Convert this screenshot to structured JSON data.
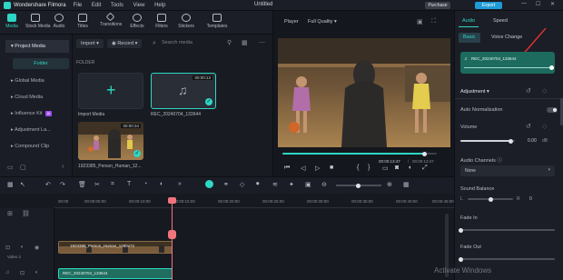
{
  "titlebar": {
    "app_name": "Wondershare Filmora",
    "menus": [
      "File",
      "Edit",
      "Tools",
      "View",
      "Help"
    ],
    "doc_title": "Untitled",
    "purchase_label": "Purchase",
    "export_label": "Export"
  },
  "toolbar": {
    "tools": [
      "Media",
      "Stock Media",
      "Audio",
      "Titles",
      "Transitions",
      "Effects",
      "Filters",
      "Stickers",
      "Templates"
    ]
  },
  "leftnav": {
    "project_media": "Project Media",
    "folder": "Folder",
    "items": [
      "Global Media",
      "Cloud Media",
      "Influence Kit",
      "Adjustment La...",
      "Compound Clip"
    ],
    "ai_badge": "AI"
  },
  "media": {
    "import_label": "Import",
    "record_label": "Record",
    "search_placeholder": "Search media",
    "folder_header": "FOLDER",
    "items": [
      {
        "label": "Import Media",
        "duration": ""
      },
      {
        "label": "REC_20240704_133644",
        "duration": "00:00:13"
      },
      {
        "label": "1923385_Person_Human_12...",
        "duration": "00:00:34"
      }
    ]
  },
  "player": {
    "title": "Player",
    "quality": "Full Quality",
    "current_time": "00:00:13:47",
    "total_time": "00:00:13:47",
    "progress": 0.92
  },
  "rightpanel": {
    "tabs": [
      "Audio",
      "Speed"
    ],
    "subtabs": [
      "Basic",
      "Voice Change"
    ],
    "clip_name": "REC_20240704_133644",
    "section": "Adjustment",
    "auto_normalization": "Auto Normalization",
    "volume_label": "Volume",
    "volume_value": "0.00",
    "volume_unit": "dB",
    "volume_level": 0.92,
    "audio_channels_label": "Audio Channels",
    "audio_channels_value": "None",
    "sound_balance_label": "Sound Balance",
    "balance_left": "L",
    "balance_value": "0",
    "balance_right": "R",
    "balance_level": 0.5,
    "fade_in_label": "Fade In",
    "fade_in_level": 0.0,
    "fade_out_label": "Fade Out",
    "fade_out_level": 0.0
  },
  "timeline": {
    "ticks": [
      "00:00",
      "00:00:05:00",
      "00:00:10:00",
      "00:00:15:00",
      "00:00:20:00",
      "00:00:25:00",
      "00:00:30:00",
      "00:00:35:00",
      "00:00:40:00",
      "00:00:45:00"
    ],
    "video_clip": "1923385_Person_Human_1280x72",
    "audio_clip": "REC_20240704_133644",
    "track_label": "Video 1"
  },
  "watermark": "Activate Windows"
}
